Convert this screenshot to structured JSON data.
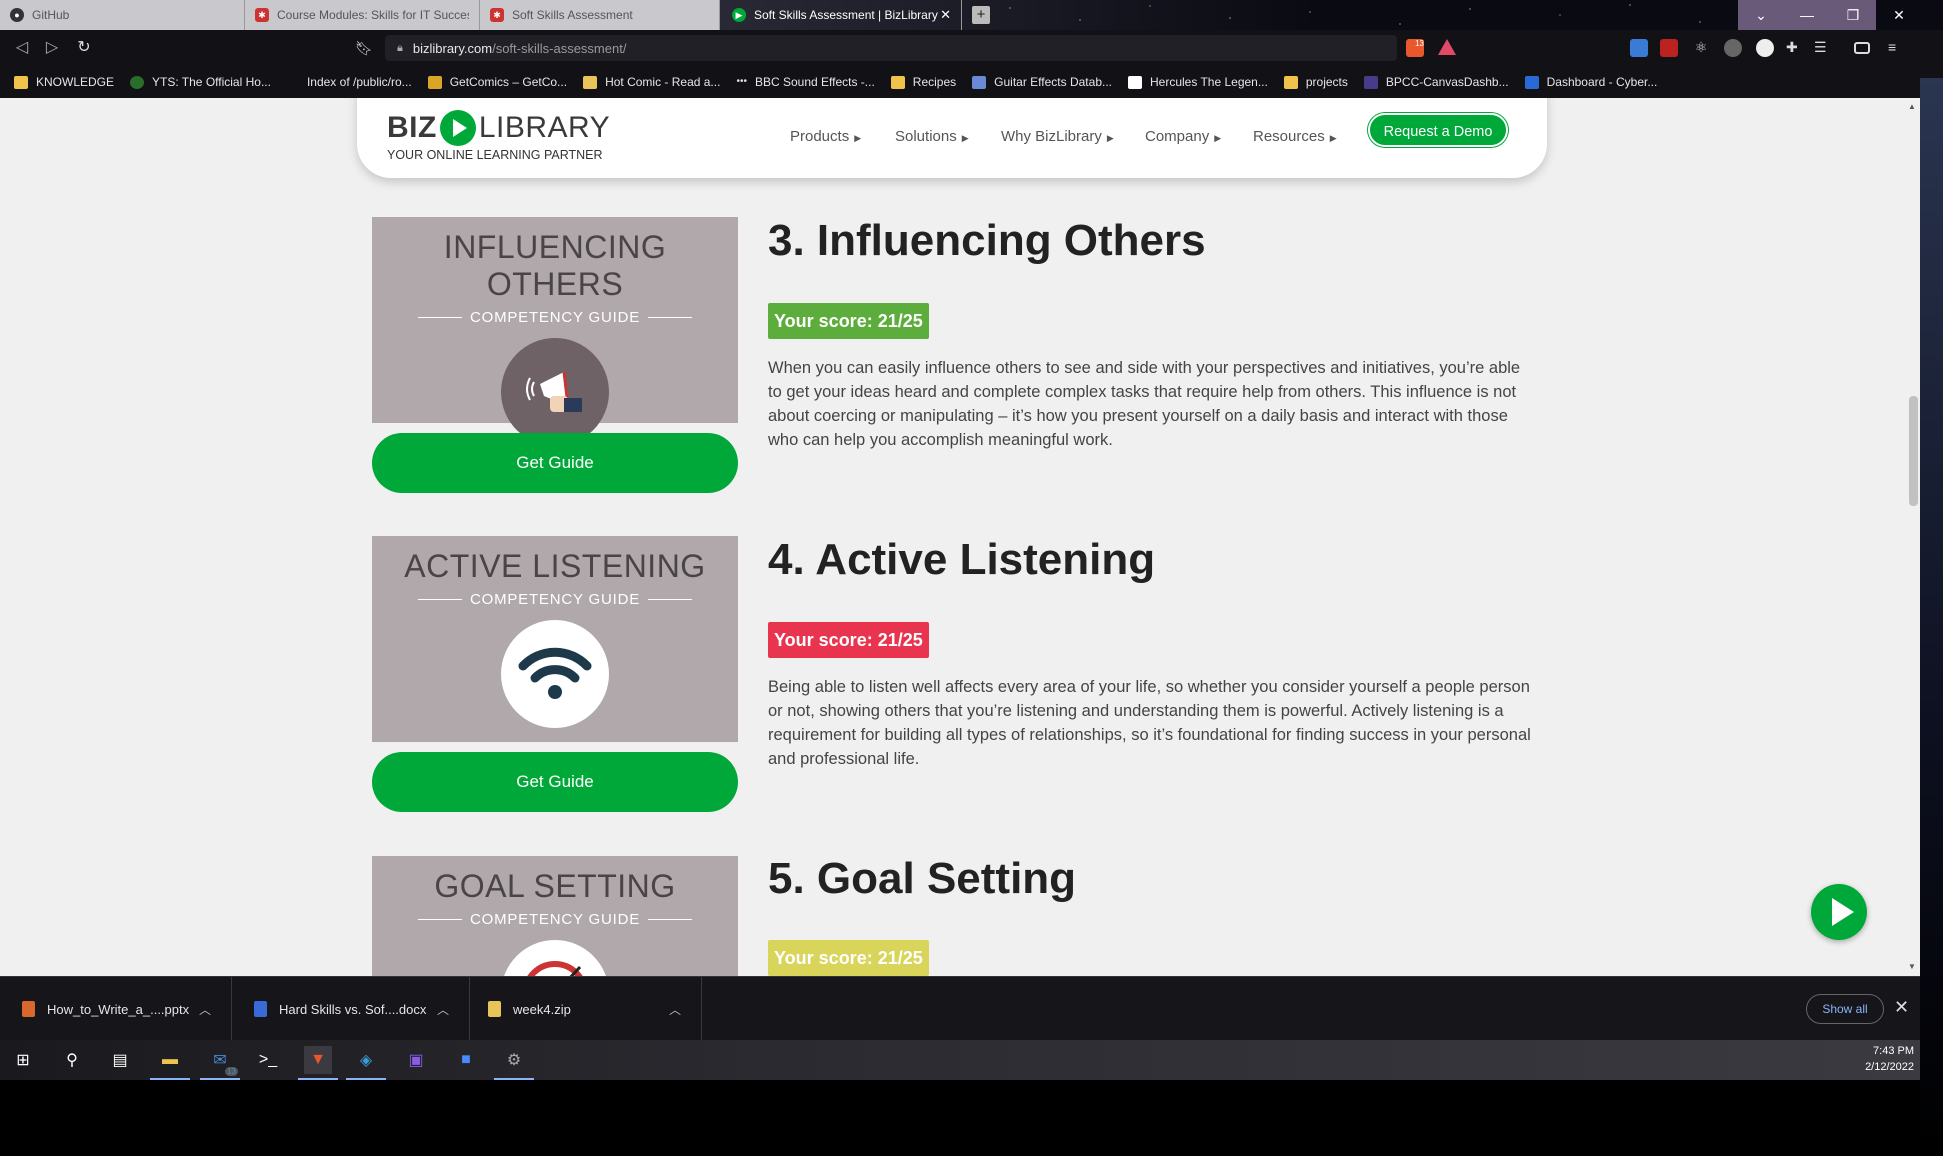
{
  "browser": {
    "tabs": [
      {
        "label": "GitHub",
        "favicon": "github-icon",
        "active": false
      },
      {
        "label": "Course Modules: Skills for IT Success",
        "favicon": "canvas-icon",
        "active": false
      },
      {
        "label": "Soft Skills Assessment",
        "favicon": "canvas-icon",
        "active": false
      },
      {
        "label": "Soft Skills Assessment | BizLibrary",
        "favicon": "bizlibrary-icon",
        "active": true
      }
    ],
    "new_tab": "+",
    "url_host": "bizlibrary.com",
    "url_path": "/soft-skills-assessment/",
    "badge_count": "13",
    "bookmarks": [
      {
        "label": "KNOWLEDGE",
        "icon": "folder-icon"
      },
      {
        "label": "YTS: The Official Ho...",
        "icon": "yts-icon"
      },
      {
        "label": "Index of /public/ro...",
        "icon": "blank-icon"
      },
      {
        "label": "GetComics – GetCo...",
        "icon": "getcomics-icon"
      },
      {
        "label": "Hot Comic - Read a...",
        "icon": "comic-icon"
      },
      {
        "label": "BBC Sound Effects -...",
        "icon": "bbc-icon"
      },
      {
        "label": "Recipes",
        "icon": "folder-icon"
      },
      {
        "label": "Guitar Effects Datab...",
        "icon": "guitar-icon"
      },
      {
        "label": "Hercules The Legen...",
        "icon": "d-icon"
      },
      {
        "label": "projects",
        "icon": "folder-icon"
      },
      {
        "label": "BPCC-CanvasDashb...",
        "icon": "bpcc-icon"
      },
      {
        "label": "Dashboard - Cyber...",
        "icon": "cs-icon"
      }
    ]
  },
  "site": {
    "logo_biz": "BIZ",
    "logo_library": "LIBRARY",
    "logo_tagline": "YOUR ONLINE LEARNING PARTNER",
    "nav": [
      "Products",
      "Solutions",
      "Why BizLibrary",
      "Company",
      "Resources"
    ],
    "cta": "Request a Demo"
  },
  "sections": [
    {
      "card_title": "INFLUENCING OTHERS",
      "card_subtitle": "COMPETENCY GUIDE",
      "button": "Get Guide",
      "title": "3. Influencing Others",
      "score": "Your score: 21/25",
      "score_color": "#5cad3c",
      "text": "When you can easily influence others to see and side with your perspectives and initiatives, you’re able to get your ideas heard and complete complex tasks that require help from others. This influence is not about coercing or manipulating – it’s how you present yourself on a daily basis and interact with those who can help you accomplish meaningful work."
    },
    {
      "card_title": "ACTIVE LISTENING",
      "card_subtitle": "COMPETENCY GUIDE",
      "button": "Get Guide",
      "title": "4. Active Listening",
      "score": "Your score: 21/25",
      "score_color": "#e8344e",
      "text": "Being able to listen well affects every area of your life, so whether you consider yourself a people person or not, showing others that you’re listening and understanding them is powerful. Actively listening is a requirement for building all types of relationships, so it’s foundational for finding success in your personal and professional life."
    },
    {
      "card_title": "GOAL SETTING",
      "card_subtitle": "COMPETENCY GUIDE",
      "title": "5. Goal Setting",
      "score": "Your score: 21/25",
      "score_color": "#d9d45a"
    }
  ],
  "downloads": {
    "items": [
      {
        "name": "How_to_Write_a_....pptx",
        "icon": "pptx-icon"
      },
      {
        "name": "Hard Skills vs. Sof....docx",
        "icon": "docx-icon"
      },
      {
        "name": "week4.zip",
        "icon": "zip-icon"
      }
    ],
    "show_all": "Show all"
  },
  "taskbar": {
    "mail_badge": "13",
    "time": "7:43 PM",
    "date": "2/12/2022"
  }
}
